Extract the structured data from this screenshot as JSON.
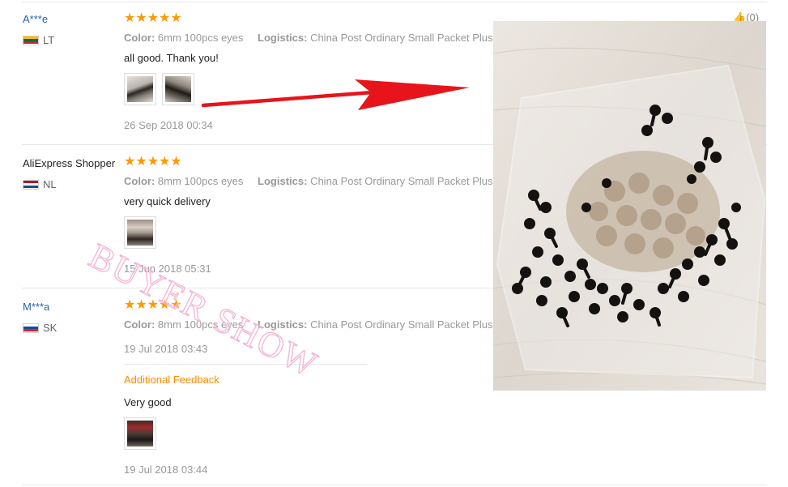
{
  "reviews": [
    {
      "name": "A***e",
      "country": "LT",
      "stars": "★★★★★",
      "color_label": "Color:",
      "color_value": "6mm 100pcs eyes",
      "logistics_label": "Logistics:",
      "logistics_value": "China Post Ordinary Small Packet Plus",
      "text": "all good. Thank you!",
      "date": "26 Sep 2018 00:34"
    },
    {
      "name": "AliExpress Shopper",
      "country": "NL",
      "stars": "★★★★★",
      "color_label": "Color:",
      "color_value": "8mm 100pcs eyes",
      "logistics_label": "Logistics:",
      "logistics_value": "China Post Ordinary Small Packet Plus",
      "text": "very quick delivery",
      "date": "15 Jun 2018 05:31"
    },
    {
      "name": "M***a",
      "country": "SK",
      "stars": "★★★★★",
      "color_label": "Color:",
      "color_value": "8mm 100pcs eyes",
      "logistics_label": "Logistics:",
      "logistics_value": "China Post Ordinary Small Packet Plus",
      "date": "19 Jul 2018 03:43",
      "additional_label": "Additional Feedback",
      "additional_text": "Very good",
      "additional_date": "19 Jul 2018 03:44"
    }
  ],
  "helpful": {
    "count": "(0)"
  },
  "watermark": "BUYER SHOW",
  "colors": {
    "star": "#ff9900",
    "name_link": "#2860b6",
    "additional": "#ff8a00",
    "arrow": "#e8141b",
    "watermark": "#f4b4d6"
  }
}
